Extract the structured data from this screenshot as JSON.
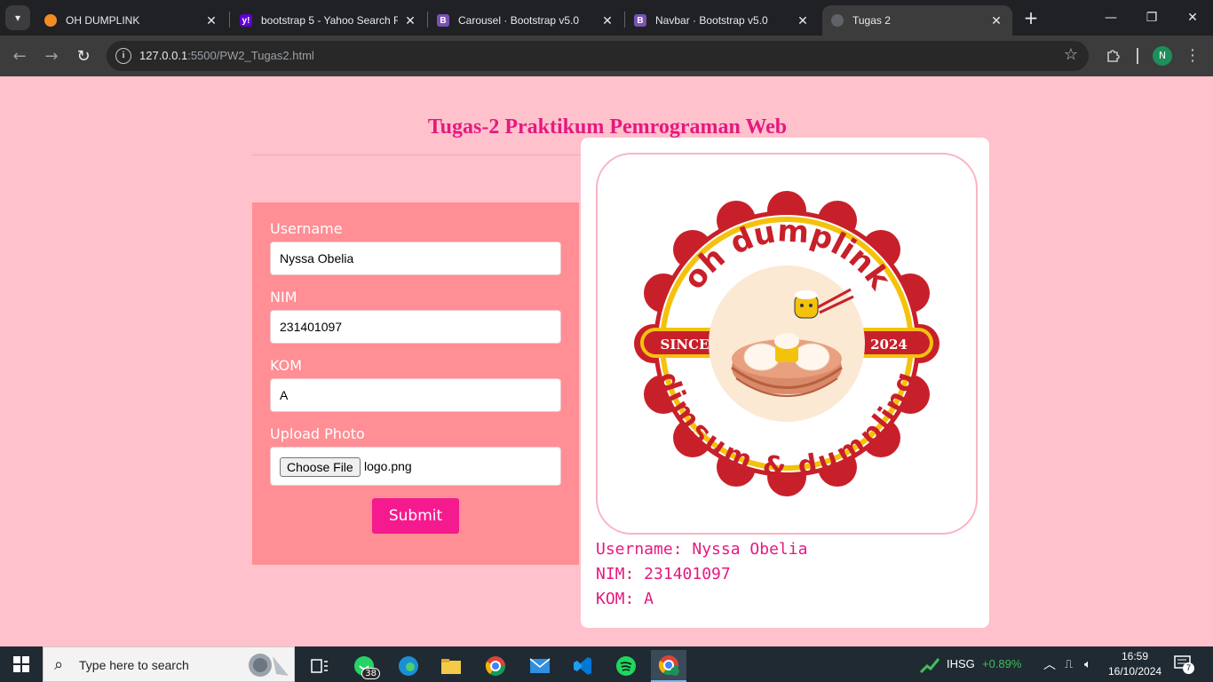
{
  "browser": {
    "tabs": [
      {
        "title": "OH DUMPLINK",
        "favicon": "dumpling-favicon",
        "color": "#f28c28"
      },
      {
        "title": "bootstrap 5 - Yahoo Search R",
        "favicon": "yahoo-favicon",
        "color": "#6001d2"
      },
      {
        "title": "Carousel · Bootstrap v5.0",
        "favicon": "bootstrap-favicon",
        "color": "#7952b3"
      },
      {
        "title": "Navbar · Bootstrap v5.0",
        "favicon": "bootstrap-favicon",
        "color": "#7952b3"
      },
      {
        "title": "Tugas 2",
        "favicon": "globe-favicon",
        "color": "#5f6368"
      }
    ],
    "url_host": "127.0.0.1",
    "url_path": ":5500/PW2_Tugas2.html",
    "profile_initial": "N"
  },
  "page": {
    "heading": "Tugas-2 Praktikum Pemrograman Web",
    "form": {
      "username_label": "Username",
      "username_value": "Nyssa Obelia",
      "nim_label": "NIM",
      "nim_value": "231401097",
      "kom_label": "KOM",
      "kom_value": "A",
      "photo_label": "Upload Photo",
      "choose_file_label": "Choose File",
      "file_name": "logo.png",
      "submit_label": "Submit"
    },
    "card": {
      "logo": {
        "top_text": "oh dumplink",
        "bottom_text": "dimsum & dumpling",
        "since_label": "SINCE",
        "year": "2024"
      },
      "username_line": "Username: Nyssa Obelia",
      "nim_line": "NIM: 231401097",
      "kom_line": "KOM: A"
    }
  },
  "taskbar": {
    "search_placeholder": "Type here to search",
    "whatsapp_badge": "38",
    "stock_name": "IHSG",
    "stock_change": "+0.89%",
    "time": "16:59",
    "date": "16/10/2024",
    "notification_count": "7"
  },
  "colors": {
    "page_bg": "#ffc1cc",
    "accent_pink": "#e6197f",
    "form_bg": "#ff8e95",
    "submit_bg": "#f51a8e",
    "logo_red": "#c8202a",
    "logo_yellow": "#f4c20d"
  }
}
